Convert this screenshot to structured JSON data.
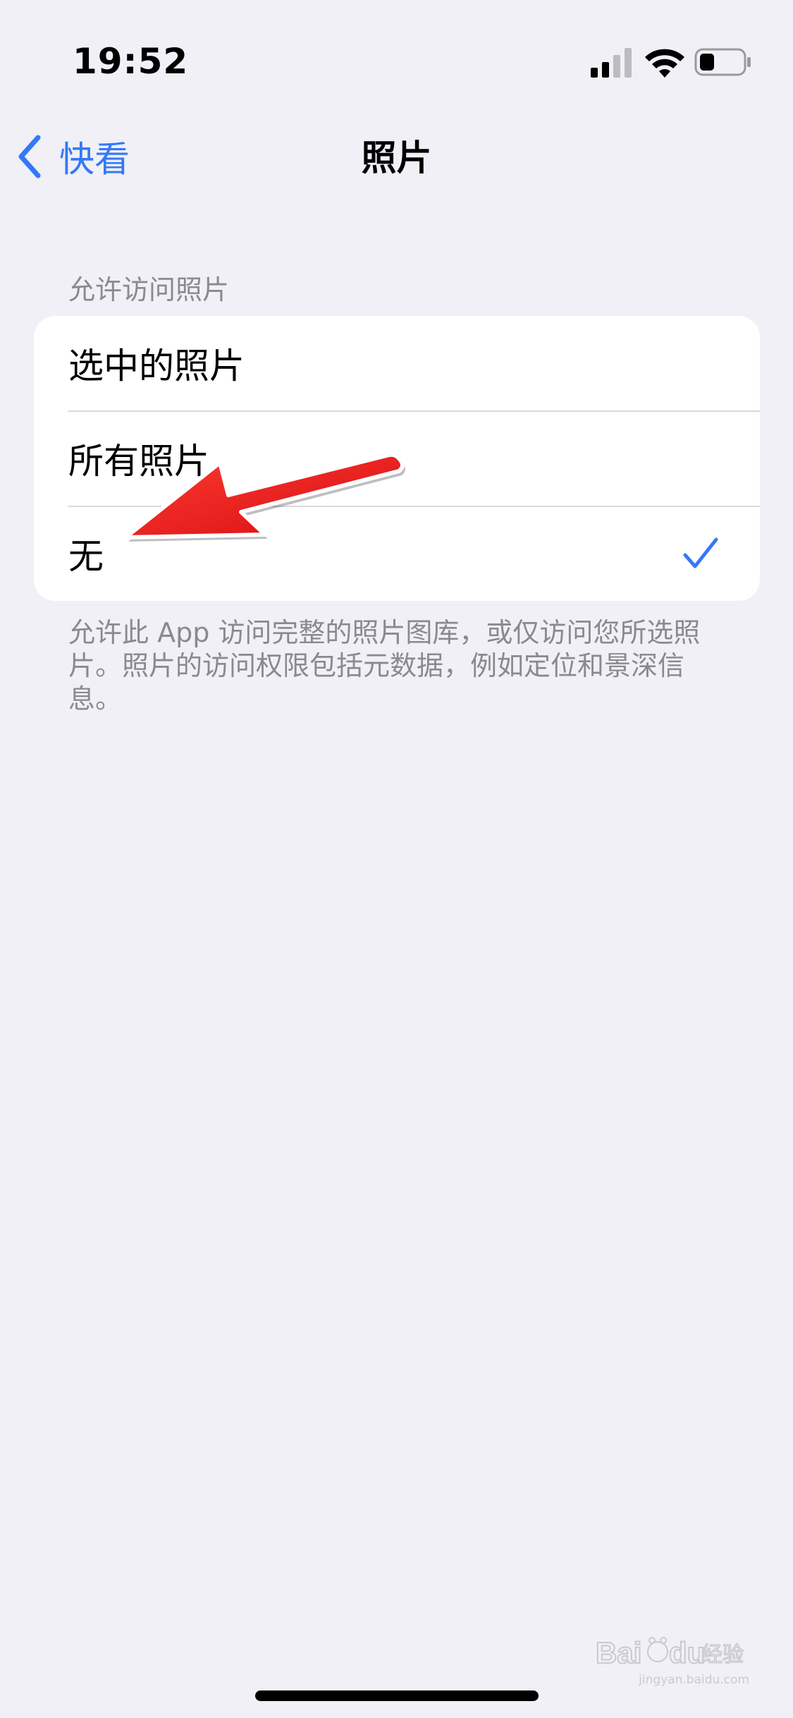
{
  "status_bar": {
    "time": "19:52",
    "battery_level": 0.35,
    "signal_bars": 2,
    "icons": [
      "signal-icon",
      "wifi-icon",
      "battery-icon"
    ]
  },
  "nav": {
    "back_label": "快看",
    "title": "照片"
  },
  "section": {
    "header": "允许访问照片",
    "options": [
      {
        "label": "选中的照片",
        "selected": false
      },
      {
        "label": "所有照片",
        "selected": false
      },
      {
        "label": "无",
        "selected": true
      }
    ],
    "footer": "允许此 App 访问完整的照片图库，或仅访问您所选照片。照片的访问权限包括元数据，例如定位和景深信息。"
  },
  "watermark": {
    "brand": "Baidu经验",
    "url": "jingyan.baidu.com"
  },
  "colors": {
    "accent": "#3478f6",
    "background": "#f0f0f6",
    "secondary_text": "#8a8a8e",
    "annotation_arrow": "#e8141b"
  }
}
